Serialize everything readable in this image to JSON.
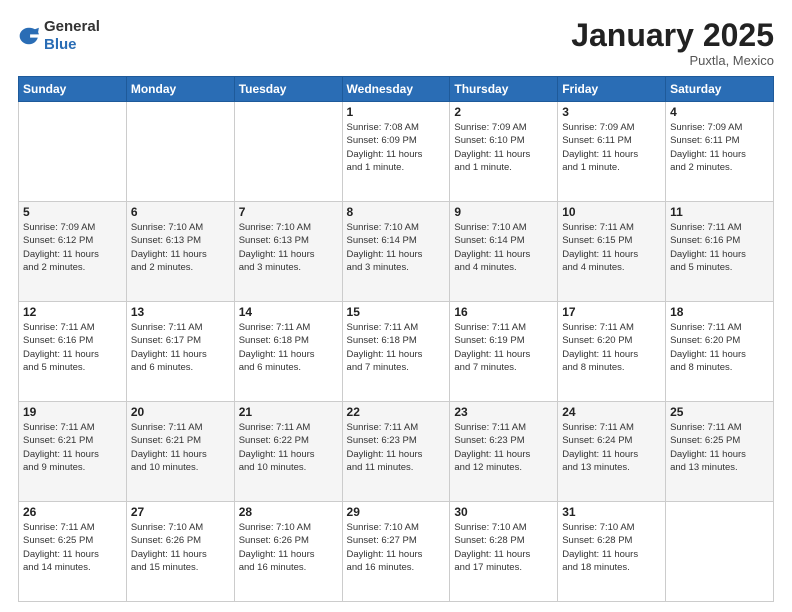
{
  "header": {
    "logo_general": "General",
    "logo_blue": "Blue",
    "month": "January 2025",
    "location": "Puxtla, Mexico"
  },
  "weekdays": [
    "Sunday",
    "Monday",
    "Tuesday",
    "Wednesday",
    "Thursday",
    "Friday",
    "Saturday"
  ],
  "weeks": [
    [
      {
        "day": "",
        "info": ""
      },
      {
        "day": "",
        "info": ""
      },
      {
        "day": "",
        "info": ""
      },
      {
        "day": "1",
        "info": "Sunrise: 7:08 AM\nSunset: 6:09 PM\nDaylight: 11 hours\nand 1 minute."
      },
      {
        "day": "2",
        "info": "Sunrise: 7:09 AM\nSunset: 6:10 PM\nDaylight: 11 hours\nand 1 minute."
      },
      {
        "day": "3",
        "info": "Sunrise: 7:09 AM\nSunset: 6:11 PM\nDaylight: 11 hours\nand 1 minute."
      },
      {
        "day": "4",
        "info": "Sunrise: 7:09 AM\nSunset: 6:11 PM\nDaylight: 11 hours\nand 2 minutes."
      }
    ],
    [
      {
        "day": "5",
        "info": "Sunrise: 7:09 AM\nSunset: 6:12 PM\nDaylight: 11 hours\nand 2 minutes."
      },
      {
        "day": "6",
        "info": "Sunrise: 7:10 AM\nSunset: 6:13 PM\nDaylight: 11 hours\nand 2 minutes."
      },
      {
        "day": "7",
        "info": "Sunrise: 7:10 AM\nSunset: 6:13 PM\nDaylight: 11 hours\nand 3 minutes."
      },
      {
        "day": "8",
        "info": "Sunrise: 7:10 AM\nSunset: 6:14 PM\nDaylight: 11 hours\nand 3 minutes."
      },
      {
        "day": "9",
        "info": "Sunrise: 7:10 AM\nSunset: 6:14 PM\nDaylight: 11 hours\nand 4 minutes."
      },
      {
        "day": "10",
        "info": "Sunrise: 7:11 AM\nSunset: 6:15 PM\nDaylight: 11 hours\nand 4 minutes."
      },
      {
        "day": "11",
        "info": "Sunrise: 7:11 AM\nSunset: 6:16 PM\nDaylight: 11 hours\nand 5 minutes."
      }
    ],
    [
      {
        "day": "12",
        "info": "Sunrise: 7:11 AM\nSunset: 6:16 PM\nDaylight: 11 hours\nand 5 minutes."
      },
      {
        "day": "13",
        "info": "Sunrise: 7:11 AM\nSunset: 6:17 PM\nDaylight: 11 hours\nand 6 minutes."
      },
      {
        "day": "14",
        "info": "Sunrise: 7:11 AM\nSunset: 6:18 PM\nDaylight: 11 hours\nand 6 minutes."
      },
      {
        "day": "15",
        "info": "Sunrise: 7:11 AM\nSunset: 6:18 PM\nDaylight: 11 hours\nand 7 minutes."
      },
      {
        "day": "16",
        "info": "Sunrise: 7:11 AM\nSunset: 6:19 PM\nDaylight: 11 hours\nand 7 minutes."
      },
      {
        "day": "17",
        "info": "Sunrise: 7:11 AM\nSunset: 6:20 PM\nDaylight: 11 hours\nand 8 minutes."
      },
      {
        "day": "18",
        "info": "Sunrise: 7:11 AM\nSunset: 6:20 PM\nDaylight: 11 hours\nand 8 minutes."
      }
    ],
    [
      {
        "day": "19",
        "info": "Sunrise: 7:11 AM\nSunset: 6:21 PM\nDaylight: 11 hours\nand 9 minutes."
      },
      {
        "day": "20",
        "info": "Sunrise: 7:11 AM\nSunset: 6:21 PM\nDaylight: 11 hours\nand 10 minutes."
      },
      {
        "day": "21",
        "info": "Sunrise: 7:11 AM\nSunset: 6:22 PM\nDaylight: 11 hours\nand 10 minutes."
      },
      {
        "day": "22",
        "info": "Sunrise: 7:11 AM\nSunset: 6:23 PM\nDaylight: 11 hours\nand 11 minutes."
      },
      {
        "day": "23",
        "info": "Sunrise: 7:11 AM\nSunset: 6:23 PM\nDaylight: 11 hours\nand 12 minutes."
      },
      {
        "day": "24",
        "info": "Sunrise: 7:11 AM\nSunset: 6:24 PM\nDaylight: 11 hours\nand 13 minutes."
      },
      {
        "day": "25",
        "info": "Sunrise: 7:11 AM\nSunset: 6:25 PM\nDaylight: 11 hours\nand 13 minutes."
      }
    ],
    [
      {
        "day": "26",
        "info": "Sunrise: 7:11 AM\nSunset: 6:25 PM\nDaylight: 11 hours\nand 14 minutes."
      },
      {
        "day": "27",
        "info": "Sunrise: 7:10 AM\nSunset: 6:26 PM\nDaylight: 11 hours\nand 15 minutes."
      },
      {
        "day": "28",
        "info": "Sunrise: 7:10 AM\nSunset: 6:26 PM\nDaylight: 11 hours\nand 16 minutes."
      },
      {
        "day": "29",
        "info": "Sunrise: 7:10 AM\nSunset: 6:27 PM\nDaylight: 11 hours\nand 16 minutes."
      },
      {
        "day": "30",
        "info": "Sunrise: 7:10 AM\nSunset: 6:28 PM\nDaylight: 11 hours\nand 17 minutes."
      },
      {
        "day": "31",
        "info": "Sunrise: 7:10 AM\nSunset: 6:28 PM\nDaylight: 11 hours\nand 18 minutes."
      },
      {
        "day": "",
        "info": ""
      }
    ]
  ]
}
